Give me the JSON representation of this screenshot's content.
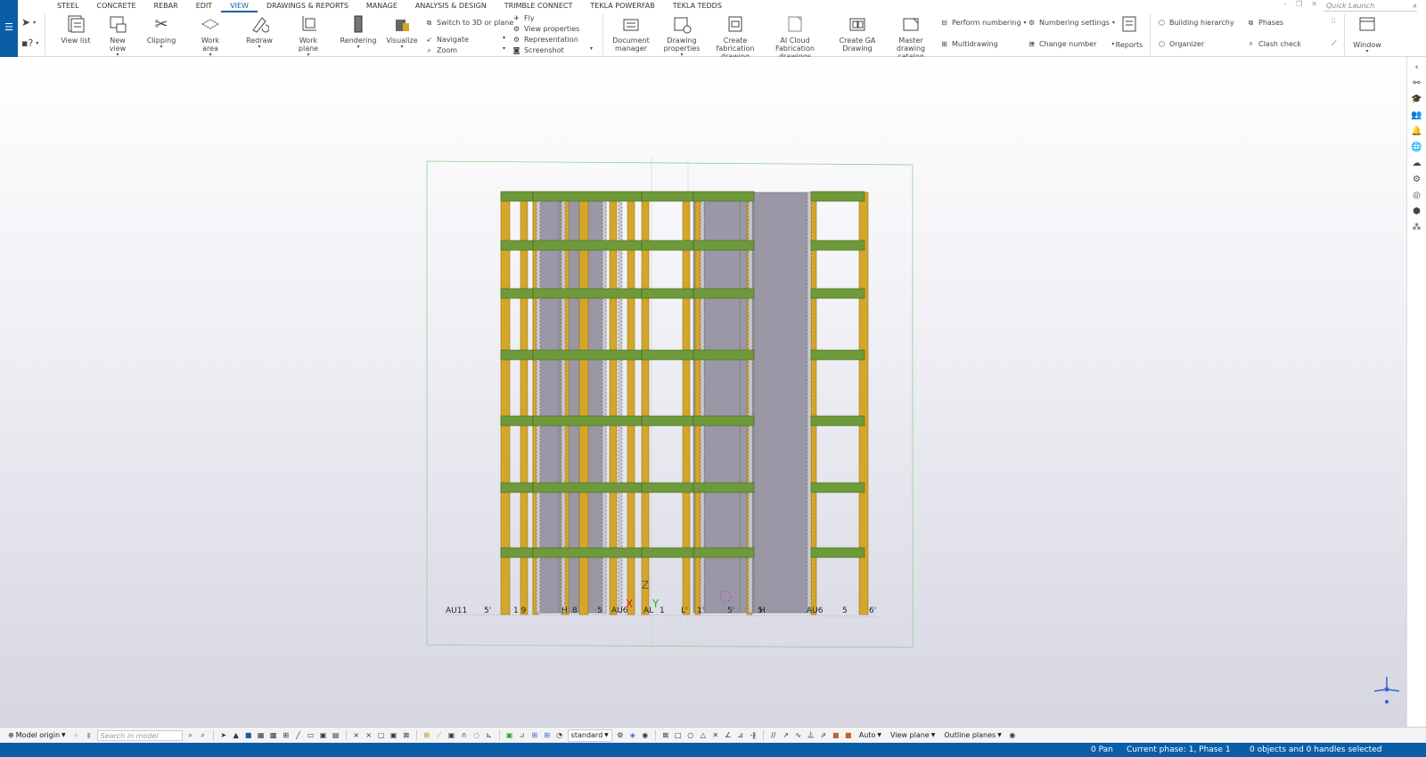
{
  "menu": {
    "tabs": [
      "STEEL",
      "CONCRETE",
      "REBAR",
      "EDIT",
      "VIEW",
      "DRAWINGS & REPORTS",
      "MANAGE",
      "ANALYSIS & DESIGN",
      "TRIMBLE CONNECT",
      "TEKLA POWERFAB",
      "TEKLA TEDDS"
    ],
    "active": "VIEW",
    "quick_launch_placeholder": "Quick Launch"
  },
  "ribbon": {
    "view_list": "View list",
    "new_view": "New view",
    "clipping": "Clipping",
    "work_area": "Work area",
    "redraw": "Redraw",
    "work_plane": "Work plane",
    "rendering": "Rendering",
    "visualize": "Visualize",
    "switch_3d": "Switch to 3D or plane",
    "navigate": "Navigate",
    "zoom": "Zoom",
    "fly": "Fly",
    "view_properties": "View properties",
    "representation": "Representation",
    "screenshot": "Screenshot",
    "document_manager": [
      "Document",
      "manager"
    ],
    "drawing_properties": [
      "Drawing",
      "properties"
    ],
    "create_fab": [
      "Create fabrication",
      "drawing"
    ],
    "ai_cloud": [
      "AI Cloud Fabrication",
      "drawings"
    ],
    "create_ga": [
      "Create GA",
      "Drawing"
    ],
    "master_catalog": [
      "Master drawing",
      "catalog"
    ],
    "perform_numbering": "Perform numbering",
    "numbering_settings": "Numbering settings",
    "multidrawing": "Multidrawing",
    "change_number": "Change number",
    "reports": "Reports",
    "building_hierarchy": "Building hierarchy",
    "phases": "Phases",
    "organizer": "Organizer",
    "clash_check": "Clash check",
    "window": "Window"
  },
  "viewport": {
    "axis_labels": {
      "z": "Z",
      "x": "X",
      "y": "Y"
    },
    "grid_labels": [
      "AU11",
      "5'",
      "1 9",
      "H",
      "8",
      "5",
      "AU6",
      "AL",
      "1",
      "L'",
      "1'",
      "5'",
      "5",
      "H",
      "AU6",
      "5",
      "6'"
    ]
  },
  "bottom_toolbar": {
    "model_origin": "Model origin",
    "search_placeholder": "Search in model",
    "selection_filter": "standard",
    "snap_mode": "Auto",
    "plane": "View plane",
    "outline": "Outline planes"
  },
  "status": {
    "command": "0 Pan",
    "phase": "Current phase: 1, Phase 1",
    "selection": "0 objects and 0 handles selected"
  },
  "colors": {
    "brand_blue": "#0a5ea8",
    "column": "#d4a62a",
    "beam": "#6e9a3a",
    "wall": "#9a98a6"
  }
}
